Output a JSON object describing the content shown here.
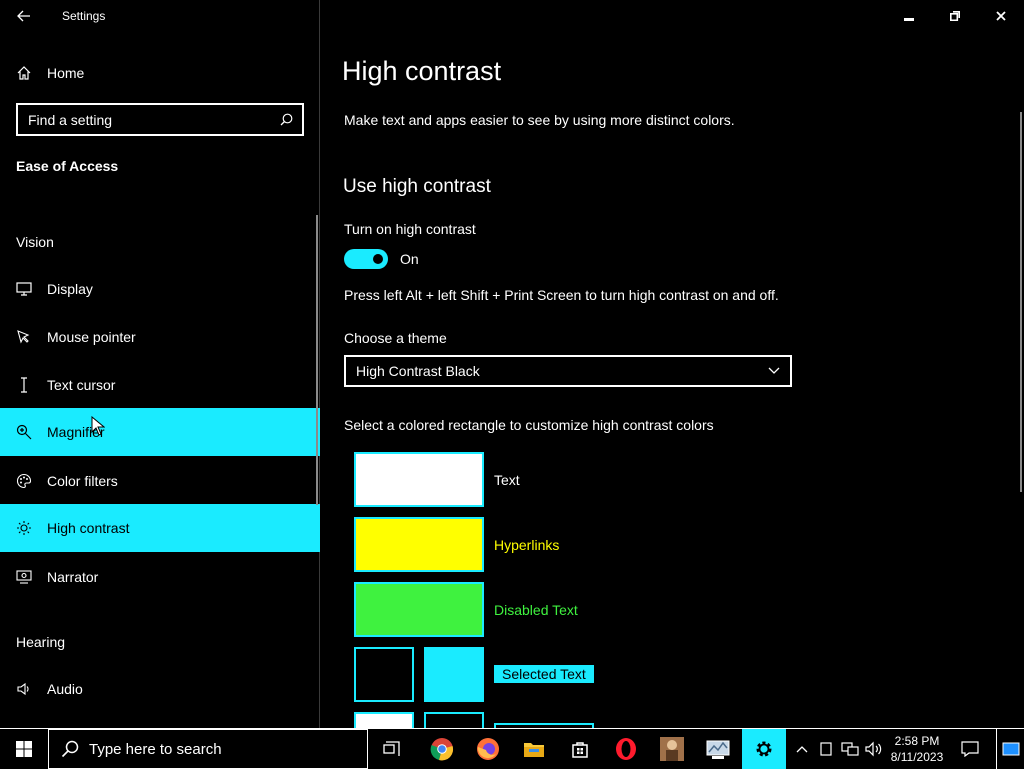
{
  "window": {
    "title": "Settings"
  },
  "sidebar": {
    "home_label": "Home",
    "search_placeholder": "Find a setting",
    "category": "Ease of Access",
    "vision_heading": "Vision",
    "items": [
      {
        "label": "Display",
        "icon": "monitor-icon"
      },
      {
        "label": "Mouse pointer",
        "icon": "mouse-pointer-icon"
      },
      {
        "label": "Text cursor",
        "icon": "text-cursor-icon"
      },
      {
        "label": "Magnifier",
        "icon": "magnifier-icon"
      },
      {
        "label": "Color filters",
        "icon": "palette-icon"
      },
      {
        "label": "High contrast",
        "icon": "sun-icon"
      },
      {
        "label": "Narrator",
        "icon": "narrator-icon"
      }
    ],
    "hearing_heading": "Hearing",
    "hearing_items": [
      {
        "label": "Audio",
        "icon": "speaker-icon"
      }
    ]
  },
  "main": {
    "title": "High contrast",
    "description": "Make text and apps easier to see by using more distinct colors.",
    "section_title": "Use high contrast",
    "toggle_label": "Turn on high contrast",
    "toggle_state": "On",
    "shortcut_text": "Press left Alt + left Shift + Print Screen to turn high contrast on and off.",
    "theme_label": "Choose a theme",
    "theme_value": "High Contrast Black",
    "colors_label": "Select a colored rectangle to customize high contrast colors",
    "color_items": [
      {
        "label": "Text",
        "color": "#ffffff"
      },
      {
        "label": "Hyperlinks",
        "color": "#ffff00"
      },
      {
        "label": "Disabled Text",
        "color": "#3ff23f"
      },
      {
        "label": "Selected Text",
        "color": "#1aebff",
        "background": "#000000"
      }
    ]
  },
  "taskbar": {
    "search_placeholder": "Type here to search",
    "time": "2:58 PM",
    "date": "8/11/2023"
  },
  "colors": {
    "accent": "#1aebff",
    "background": "#000000",
    "text": "#ffffff"
  }
}
